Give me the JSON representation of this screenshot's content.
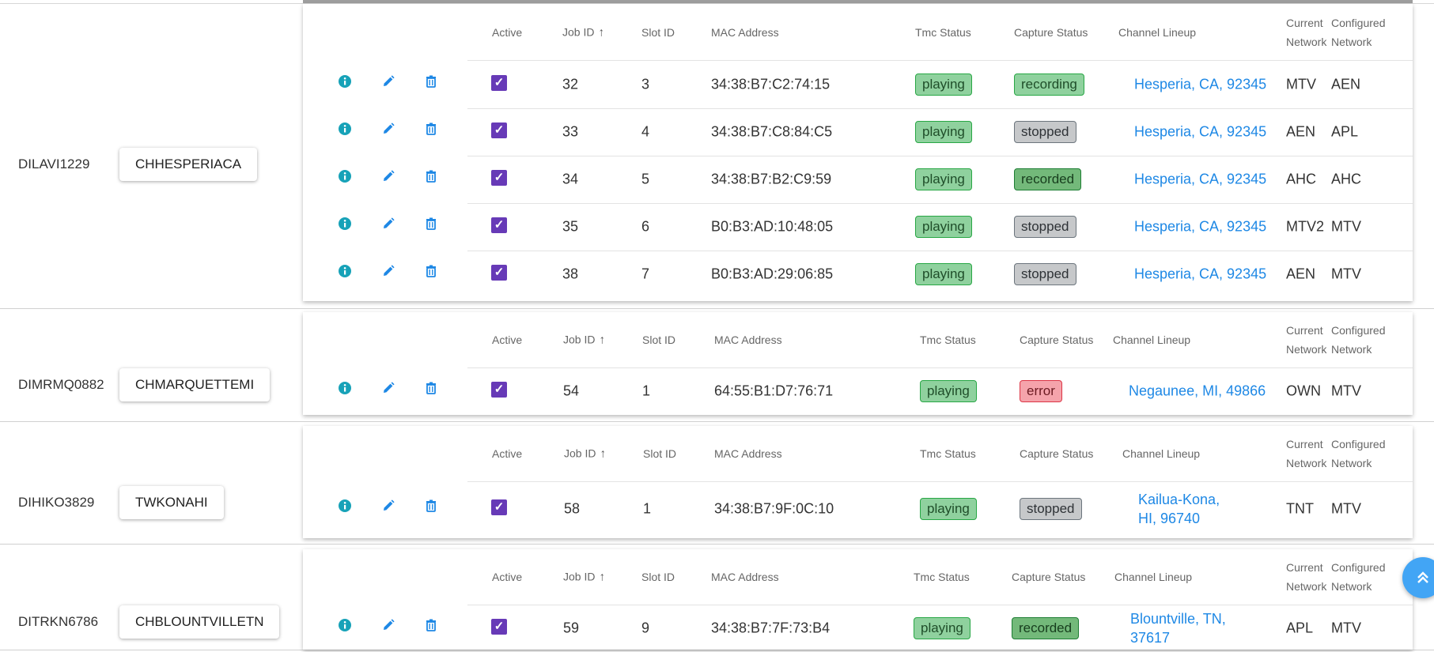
{
  "columns": {
    "active": "Active",
    "job_id": "Job ID",
    "slot_id": "Slot ID",
    "mac": "MAC Address",
    "tmc": "Tmc Status",
    "capture": "Capture Status",
    "lineup": "Channel Lineup",
    "current_line1": "Current",
    "current_line2": "Network",
    "configured_line1": "Configured",
    "configured_line2": "Network"
  },
  "sort_indicator": "arrow-up-icon",
  "icons": {
    "info": "info-icon",
    "edit": "pencil-icon",
    "delete": "trash-icon",
    "scroll_top": "double-chevron-up-icon"
  },
  "colors": {
    "checkbox": "#673ab7",
    "lineup_link": "#1e88e5",
    "info_icon": "#17a2b8",
    "edit_icon": "#1e88e5",
    "delete_icon": "#1e88e5",
    "fab": "#42a5f5"
  },
  "groups": [
    {
      "device_id": "DILAVI1229",
      "channel": "CHHESPERIACA",
      "rows": [
        {
          "job_id": "32",
          "slot_id": "3",
          "mac": "34:38:B7:C2:74:15",
          "tmc": "playing",
          "capture": "recording",
          "lineup": "Hesperia, CA, 92345",
          "current": "MTV",
          "configured": "AEN"
        },
        {
          "job_id": "33",
          "slot_id": "4",
          "mac": "34:38:B7:C8:84:C5",
          "tmc": "playing",
          "capture": "stopped",
          "lineup": "Hesperia, CA, 92345",
          "current": "AEN",
          "configured": "APL"
        },
        {
          "job_id": "34",
          "slot_id": "5",
          "mac": "34:38:B7:B2:C9:59",
          "tmc": "playing",
          "capture": "recorded",
          "lineup": "Hesperia, CA, 92345",
          "current": "AHC",
          "configured": "AHC"
        },
        {
          "job_id": "35",
          "slot_id": "6",
          "mac": "B0:B3:AD:10:48:05",
          "tmc": "playing",
          "capture": "stopped",
          "lineup": "Hesperia, CA, 92345",
          "current": "MTV2",
          "configured": "MTV"
        },
        {
          "job_id": "38",
          "slot_id": "7",
          "mac": "B0:B3:AD:29:06:85",
          "tmc": "playing",
          "capture": "stopped",
          "lineup": "Hesperia, CA, 92345",
          "current": "AEN",
          "configured": "MTV"
        }
      ]
    },
    {
      "device_id": "DIMRMQ0882",
      "channel": "CHMARQUETTEMI",
      "rows": [
        {
          "job_id": "54",
          "slot_id": "1",
          "mac": "64:55:B1:D7:76:71",
          "tmc": "playing",
          "capture": "error",
          "lineup": "Negaunee, MI, 49866",
          "current": "OWN",
          "configured": "MTV"
        }
      ]
    },
    {
      "device_id": "DIHIKO3829",
      "channel": "TWKONAHI",
      "rows": [
        {
          "job_id": "58",
          "slot_id": "1",
          "mac": "34:38:B7:9F:0C:10",
          "tmc": "playing",
          "capture": "stopped",
          "lineup": "Kailua-Kona, HI, 96740",
          "current": "TNT",
          "configured": "MTV"
        }
      ]
    },
    {
      "device_id": "DITRKN6786",
      "channel": "CHBLOUNTVILLETN",
      "rows": [
        {
          "job_id": "59",
          "slot_id": "9",
          "mac": "34:38:B7:7F:73:B4",
          "tmc": "playing",
          "capture": "recorded",
          "lineup": "Blountville, TN, 37617",
          "current": "APL",
          "configured": "MTV"
        }
      ]
    }
  ]
}
